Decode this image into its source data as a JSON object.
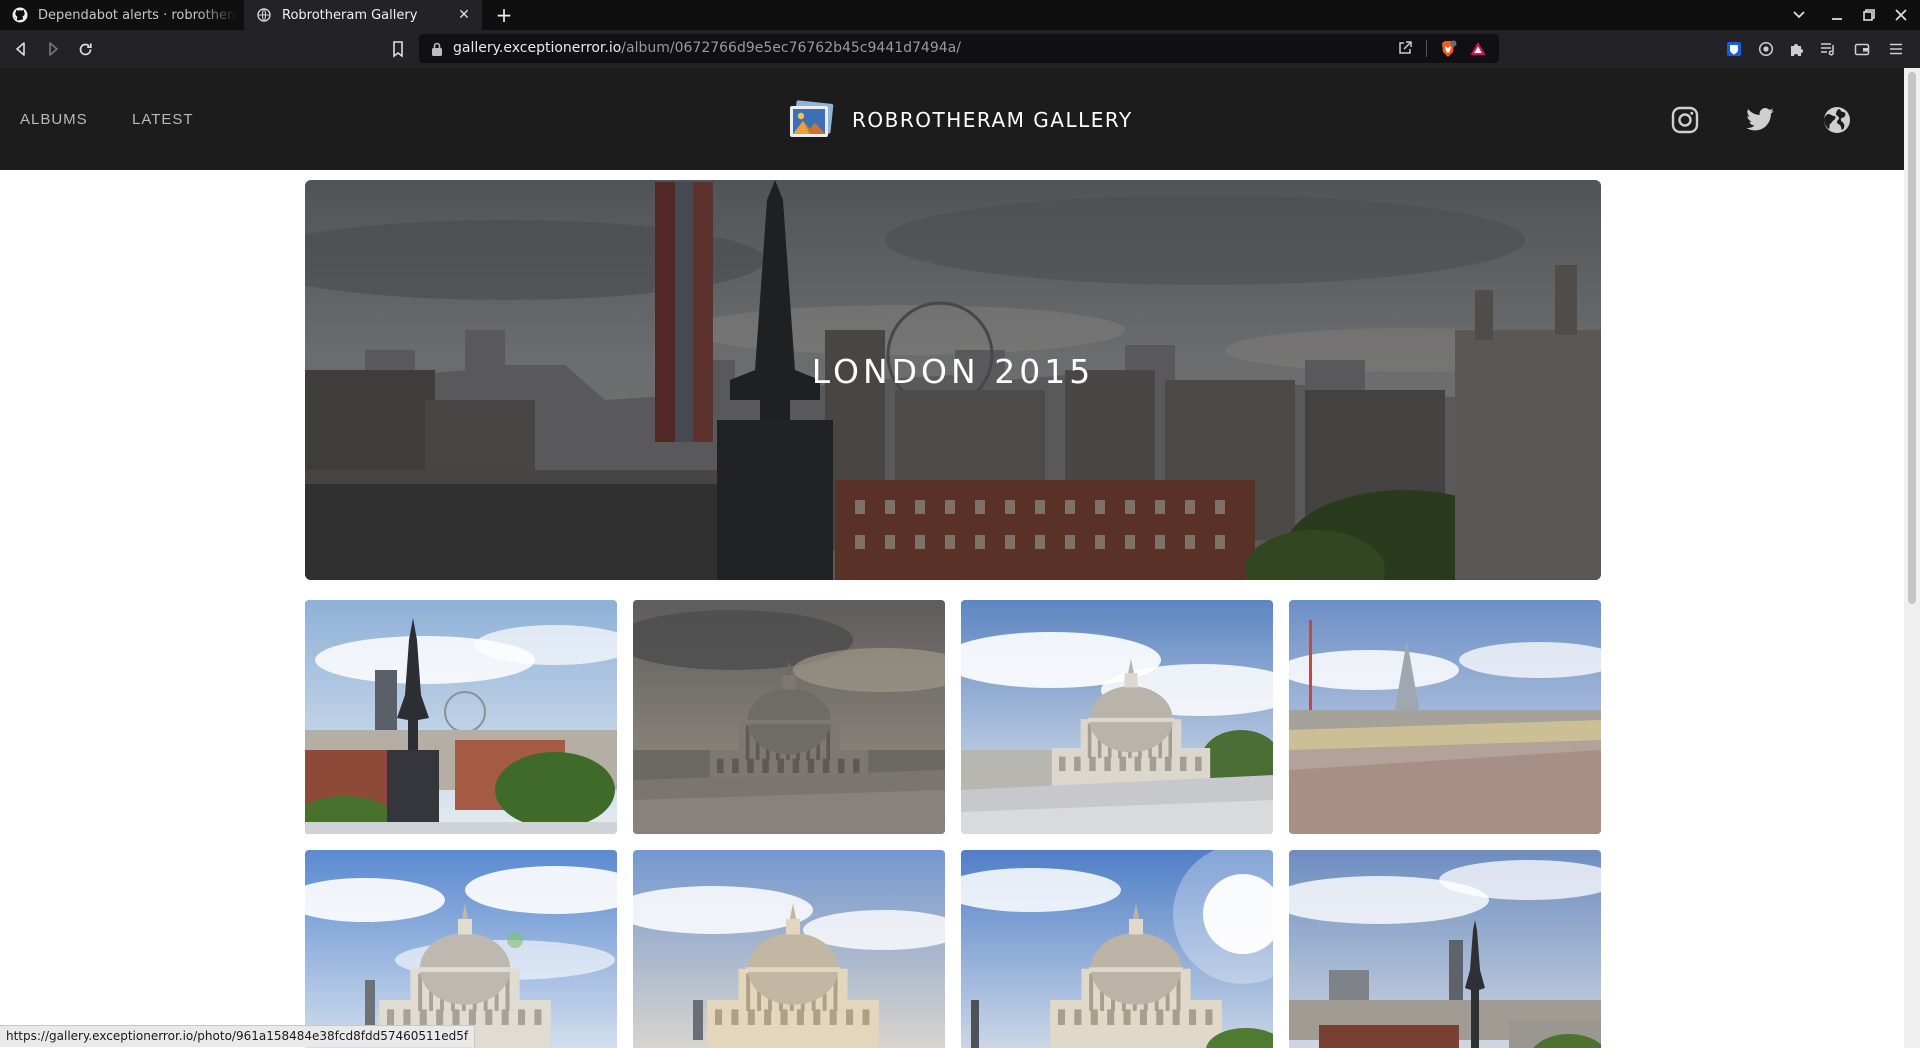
{
  "browser": {
    "tabs": [
      {
        "title": "Dependabot alerts · robrotheram",
        "active": false
      },
      {
        "title": "Robrotheram Gallery",
        "active": true
      }
    ],
    "url_host": "gallery.exceptionerror.io",
    "url_path": "/album/0672766d9e5ec76762b45c9441d7494a/",
    "status_url": "https://gallery.exceptionerror.io/photo/961a158484e38fcd8fdd57460511ed5f"
  },
  "site": {
    "nav": {
      "albums": "ALBUMS",
      "latest": "LATEST"
    },
    "brand": "ROBROTHERAM GALLERY",
    "social": [
      "instagram-icon",
      "twitter-icon",
      "globe-icon"
    ]
  },
  "album": {
    "title": "LONDON 2015",
    "photos": [
      {
        "subject": "skyline-spire"
      },
      {
        "subject": "st-pauls-dusk"
      },
      {
        "subject": "st-pauls-day"
      },
      {
        "subject": "shard-rooftop"
      },
      {
        "subject": "st-pauls-front"
      },
      {
        "subject": "st-pauls-warm"
      },
      {
        "subject": "st-pauls-sun"
      },
      {
        "subject": "skyline-tower"
      }
    ]
  },
  "colors": {
    "header_bg": "#1c1c1c",
    "chrome_bg": "#232327",
    "accent": "#ffffff"
  }
}
